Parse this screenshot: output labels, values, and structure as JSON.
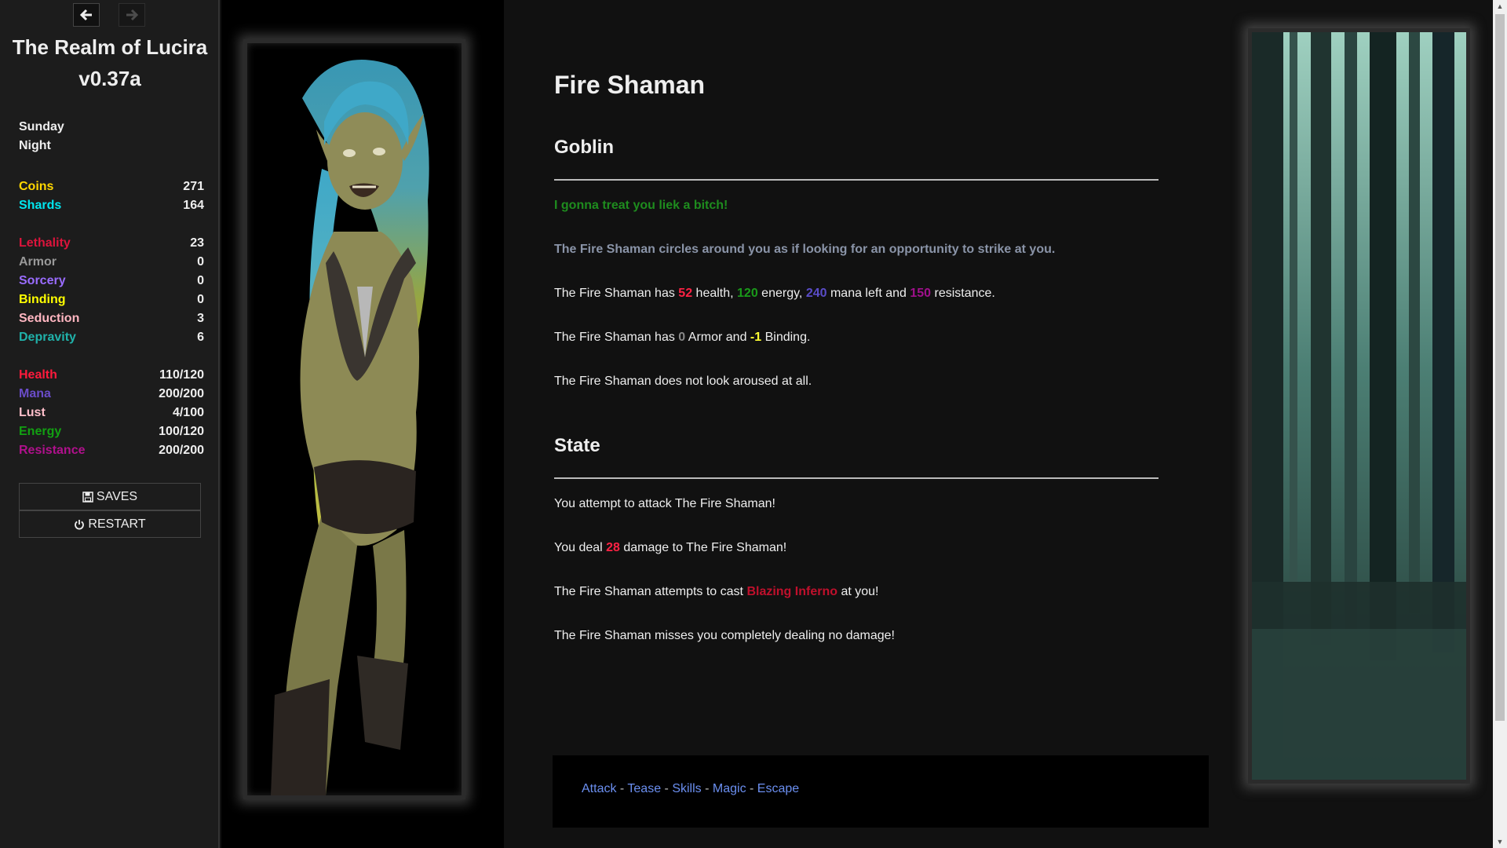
{
  "sidebar": {
    "title": "The Realm of Lucira v0.37a",
    "day": "Sunday",
    "time": "Night",
    "currency": [
      {
        "label": "Coins",
        "value": "271",
        "color": "#ffd700"
      },
      {
        "label": "Shards",
        "value": "164",
        "color": "#00e5ee"
      }
    ],
    "attributes": [
      {
        "label": "Lethality",
        "value": "23",
        "color": "#dc143c"
      },
      {
        "label": "Armor",
        "value": "0",
        "color": "#999999"
      },
      {
        "label": "Sorcery",
        "value": "0",
        "color": "#9a6cff"
      },
      {
        "label": "Binding",
        "value": "0",
        "color": "#ffff00"
      },
      {
        "label": "Seduction",
        "value": "3",
        "color": "#ffb6c1"
      },
      {
        "label": "Depravity",
        "value": "6",
        "color": "#20b2aa"
      }
    ],
    "vitals": [
      {
        "label": "Health",
        "value": "110/120",
        "color": "#ff1a3c"
      },
      {
        "label": "Mana",
        "value": "200/200",
        "color": "#6a4cc8"
      },
      {
        "label": "Lust",
        "value": "4/100",
        "color": "#ffc0cb"
      },
      {
        "label": "Energy",
        "value": "100/120",
        "color": "#12a012"
      },
      {
        "label": "Resistance",
        "value": "200/200",
        "color": "#b0108c"
      }
    ],
    "saves_label": "SAVES",
    "restart_label": "RESTART"
  },
  "passage": {
    "title": "Fire Shaman",
    "subtitle": "Goblin",
    "taunt": "I gonna treat you liek a bitch!",
    "flavor": "The Fire Shaman circles around you as if looking for an opportunity to strike at you.",
    "stats_line": {
      "p1": "The Fire Shaman has ",
      "health": "52",
      "p2": " health, ",
      "energy": "120",
      "p3": " energy, ",
      "mana": "240",
      "p4": " mana left and ",
      "resistance": "150",
      "p5": " resistance."
    },
    "armor_line": {
      "p1": "The Fire Shaman has ",
      "armor": "0",
      "p2": " Armor and ",
      "binding": "-1",
      "p3": " Binding."
    },
    "arousal": "The Fire Shaman does not look aroused at all.",
    "state_heading": "State",
    "log": {
      "attempt": "You attempt to attack The Fire Shaman!",
      "deal_p1": "You deal ",
      "deal_value": "28",
      "deal_p2": " damage to The Fire Shaman!",
      "cast_p1": "The Fire Shaman attempts to cast ",
      "cast_spell": "Blazing Inferno",
      "cast_p2": " at you!",
      "miss": "The Fire Shaman misses you completely dealing no damage!"
    }
  },
  "actions": {
    "attack": "Attack",
    "tease": "Tease",
    "skills": "Skills",
    "magic": "Magic",
    "escape": "Escape",
    "separator": " - "
  },
  "colors": {
    "taunt": "#1e8c1e",
    "flavor": "#8a94a8",
    "health": "#ff2244",
    "energy": "#1a9a1a",
    "mana": "#5a4cc8",
    "resistance": "#a0108c",
    "armor_value": "#888888",
    "binding_value": "#ffff33",
    "damage": "#ff2244",
    "spell": "#c0102c",
    "link": "#6b8ff0"
  },
  "icons": {
    "back": "arrow-left-icon",
    "forward": "arrow-right-icon",
    "saves": "floppy-disk-icon",
    "restart": "power-icon"
  }
}
